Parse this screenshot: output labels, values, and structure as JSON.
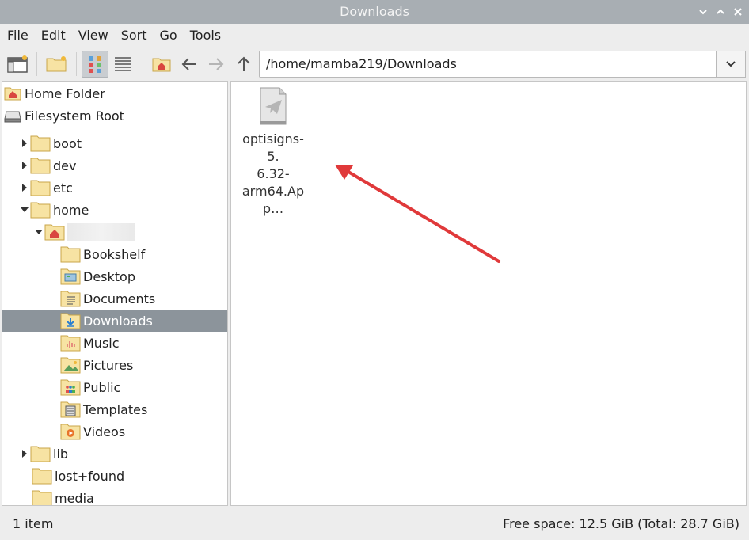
{
  "window": {
    "title": "Downloads"
  },
  "menu": [
    "File",
    "Edit",
    "View",
    "Sort",
    "Go",
    "Tools"
  ],
  "path": {
    "value": "/home/mamba219/Downloads"
  },
  "places": [
    {
      "label": "Home Folder",
      "icon": "home-icon"
    },
    {
      "label": "Filesystem Root",
      "icon": "drive-icon"
    }
  ],
  "tree": {
    "root_items": {
      "boot": "boot",
      "dev": "dev",
      "etc": "etc",
      "home": "home",
      "lib": "lib",
      "lost_found": "lost+found",
      "media": "media"
    },
    "home_children": {
      "bookshelf": "Bookshelf",
      "desktop": "Desktop",
      "documents": "Documents",
      "downloads": "Downloads",
      "music": "Music",
      "pictures": "Pictures",
      "public": "Public",
      "templates": "Templates",
      "videos": "Videos"
    },
    "selected": "Downloads"
  },
  "files": [
    {
      "name_line1": "optisigns-5.",
      "name_line2": "6.32-",
      "name_line3": "arm64.App…"
    }
  ],
  "status": {
    "count": "1 item",
    "free_space": "Free space: 12.5 GiB (Total: 28.7 GiB)"
  },
  "colors": {
    "titlebar": "#a8aeb3",
    "selection": "#8c949b",
    "annotation_arrow": "#e0393a",
    "folder": "#f7e3a3"
  }
}
